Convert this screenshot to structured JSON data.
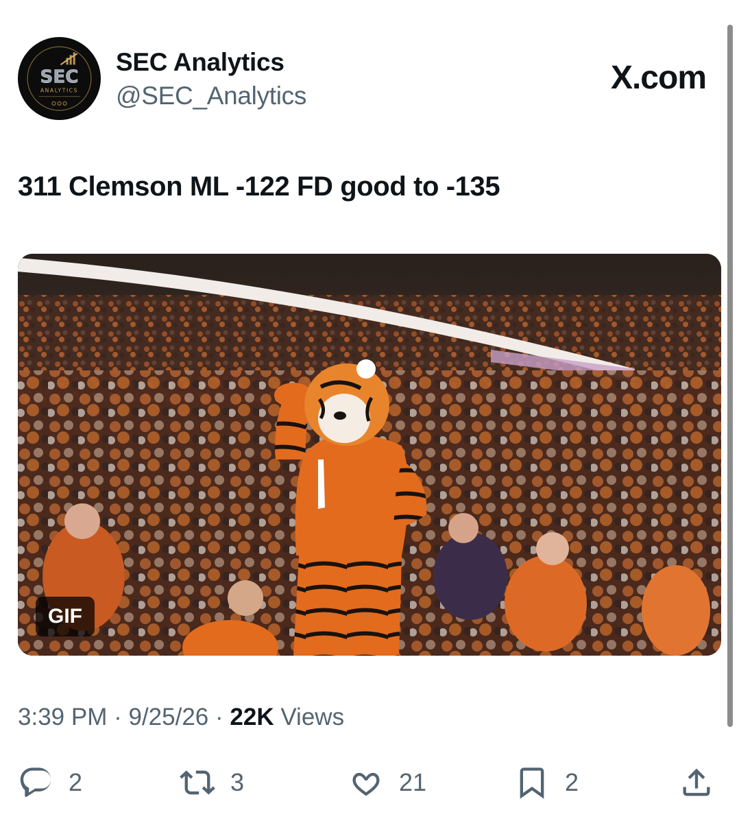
{
  "account": {
    "name": "SEC Analytics",
    "handle": "@SEC_Analytics",
    "avatar_text": "SEC",
    "avatar_subtext": "ANALYTICS"
  },
  "site_logo": "X.com",
  "tweet": {
    "text": "311 Clemson ML -122 FD good to -135",
    "media_badge": "GIF",
    "time": "3:39 PM",
    "date": "9/25/26",
    "views_count": "22K",
    "views_label": "Views",
    "separator": "·"
  },
  "actions": {
    "replies": "2",
    "reposts": "3",
    "likes": "21",
    "bookmarks": "2"
  },
  "colors": {
    "text": "#0f1419",
    "secondary": "#536471",
    "clemson_orange": "#e2641c"
  }
}
